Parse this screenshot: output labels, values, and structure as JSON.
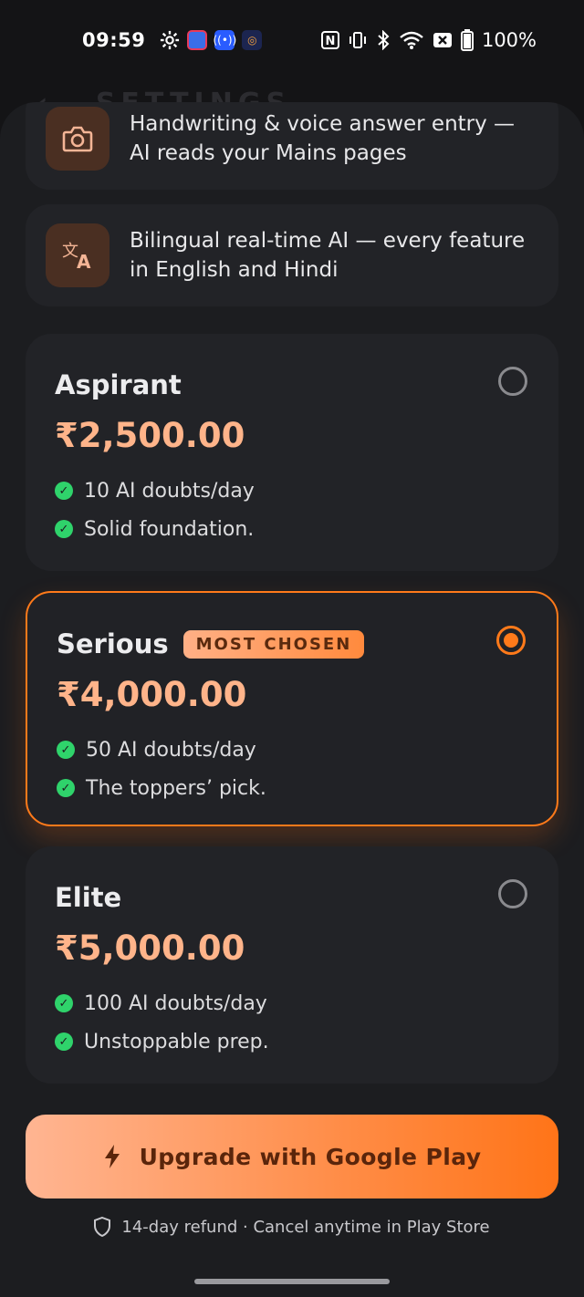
{
  "status_bar": {
    "time": "09:59",
    "battery": "100%"
  },
  "background": {
    "header_title": "SETTINGS"
  },
  "features": [
    {
      "icon": "camera-icon",
      "text": "Handwriting & voice answer entry — AI reads your Mains pages"
    },
    {
      "icon": "translate-icon",
      "text": "Bilingual real-time AI — every feature in English and Hindi"
    }
  ],
  "plans": [
    {
      "name": "Aspirant",
      "price": "₹2,500.00",
      "perks": [
        "10 AI doubts/day",
        "Solid foundation."
      ],
      "selected": false
    },
    {
      "name": "Serious",
      "badge": "MOST CHOSEN",
      "price": "₹4,000.00",
      "perks": [
        "50 AI doubts/day",
        "The toppers’ pick."
      ],
      "selected": true
    },
    {
      "name": "Elite",
      "price": "₹5,000.00",
      "perks": [
        "100 AI doubts/day",
        "Unstoppable prep."
      ],
      "selected": false
    }
  ],
  "cta": {
    "label": "Upgrade with Google Play",
    "icon": "bolt-icon"
  },
  "footnote": {
    "text": "14-day refund · Cancel anytime in Play Store",
    "icon": "shield-icon"
  },
  "colors": {
    "accent": "#ff7a1a",
    "price": "#ffb48a",
    "check": "#2fd36b",
    "sheet": "#1c1d20",
    "card": "#222327"
  }
}
